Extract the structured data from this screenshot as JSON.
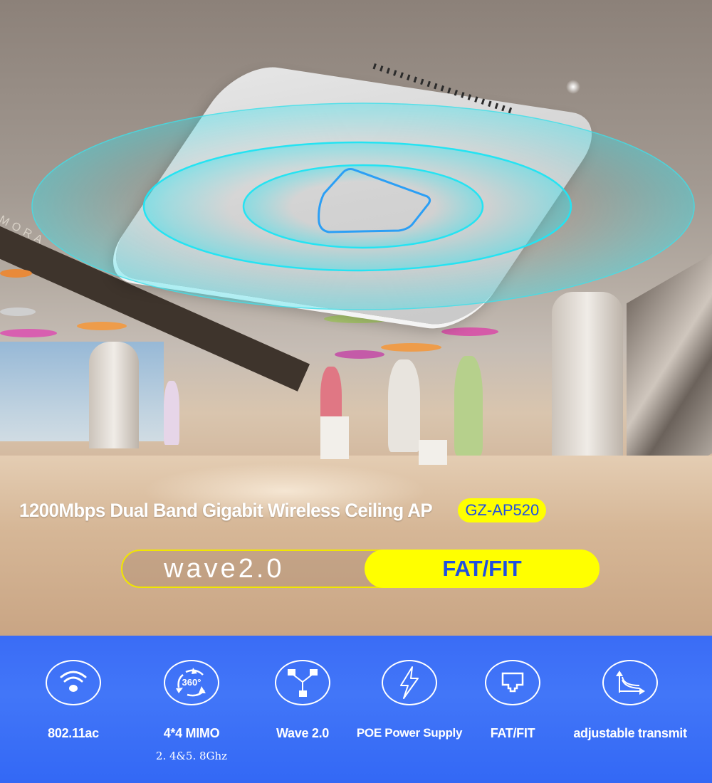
{
  "hero": {
    "background_scene": "shopping mall interior",
    "store_sign_text": "MORA",
    "device": "ceiling wireless access point"
  },
  "headline": {
    "title": "1200Mbps Dual Band Gigabit Wireless Ceiling AP",
    "model": "GZ-AP520"
  },
  "pill": {
    "left_label": "wave2.0",
    "right_label": "FAT/FIT"
  },
  "colors": {
    "accent_yellow": "#ffff00",
    "accent_blue_text": "#1f4fe0",
    "feature_bar_blue": "#3a6cf6",
    "signal_ring_cyan": "#2fe3f0"
  },
  "features": [
    {
      "icon": "wifi-icon",
      "label": "802.11ac",
      "sublabel": ""
    },
    {
      "icon": "rotate-360-icon",
      "label": "4*4 MIMO",
      "sublabel": "2. 4&5. 8Ghz"
    },
    {
      "icon": "network-topology-icon",
      "label": "Wave 2.0",
      "sublabel": ""
    },
    {
      "icon": "lightning-icon",
      "label": "POE Power Supply",
      "sublabel": ""
    },
    {
      "icon": "ethernet-port-icon",
      "label": "FAT/FIT",
      "sublabel": ""
    },
    {
      "icon": "transmit-curve-icon",
      "label": "adjustable transmit",
      "sublabel": ""
    }
  ]
}
